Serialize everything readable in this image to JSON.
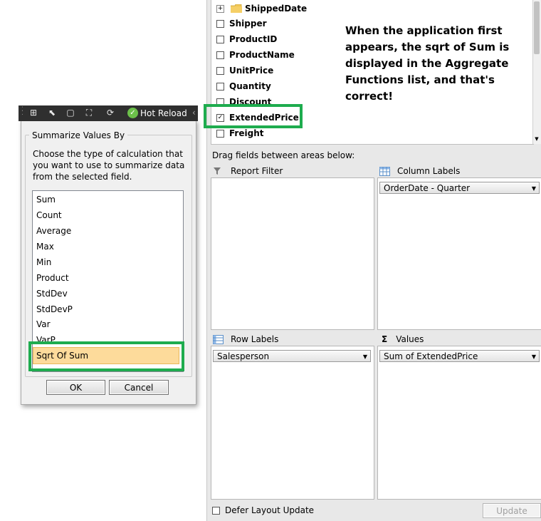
{
  "field_list": {
    "fields": [
      {
        "label": "ShippedDate",
        "checked": false,
        "icon": "folder-icon"
      },
      {
        "label": "Shipper",
        "checked": false
      },
      {
        "label": "ProductID",
        "checked": false
      },
      {
        "label": "ProductName",
        "checked": false
      },
      {
        "label": "UnitPrice",
        "checked": false
      },
      {
        "label": "Quantity",
        "checked": false
      },
      {
        "label": "Discount",
        "checked": false
      },
      {
        "label": "ExtendedPrice",
        "checked": true
      },
      {
        "label": "Freight",
        "checked": false
      }
    ],
    "expander": "+",
    "checkmark": "✓"
  },
  "annotation": "When the application first appears, the sqrt of Sum is displayed in the Aggregate Functions list, and that's correct!",
  "areas": {
    "instructions": "Drag fields between areas below:",
    "report_filter": {
      "label": "Report Filter"
    },
    "column_labels": {
      "label": "Column Labels",
      "combo": "OrderDate - Quarter"
    },
    "row_labels": {
      "label": "Row Labels",
      "combo": "Salesperson"
    },
    "values": {
      "label": "Values",
      "combo": "Sum of ExtendedPrice",
      "sigma": "Σ"
    }
  },
  "footer": {
    "defer_label": "Defer Layout Update",
    "defer_checked": false,
    "update_label": "Update"
  },
  "toolbar": {
    "hot_reload": "Hot Reload",
    "collapse": "‹"
  },
  "dialog": {
    "group_title": "Summarize Values By",
    "description": "Choose the type of calculation that you want to use to summarize data from the selected field.",
    "functions": [
      "Sum",
      "Count",
      "Average",
      "Max",
      "Min",
      "Product",
      "StdDev",
      "StdDevP",
      "Var",
      "VarP",
      "Sqrt Of Sum"
    ],
    "selected": "Sqrt Of Sum",
    "ok_label": "OK",
    "cancel_label": "Cancel"
  },
  "colors": {
    "highlight": "#1eac4e",
    "selection": "#fddb9b",
    "toolbar_bg": "#2f2f2f"
  }
}
